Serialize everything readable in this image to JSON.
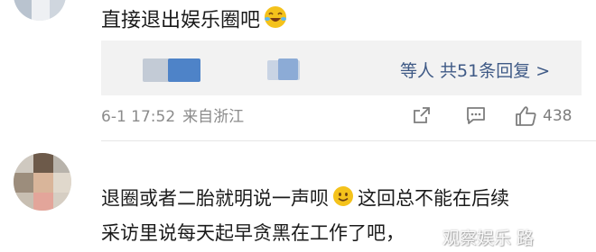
{
  "comment1": {
    "text": "直接退出娱乐圈吧",
    "emoji": "laughing-tears-face",
    "replies": {
      "summary": "等人 共51条回复",
      "chevron": ">"
    },
    "meta": {
      "date": "6-1 17:52",
      "location": "来自浙江"
    },
    "like_count": "438"
  },
  "comment2": {
    "line1": "退圈或者二胎就明说一声呗",
    "line1_after_emoji": "这回总不能在后续",
    "line2": "采访里说每天起早贪黑在工作了吧，",
    "emoji": "smiley-face"
  },
  "watermark": "观察娱乐  路",
  "colors": {
    "link": "#3f5a86",
    "meta": "#8b8b8b",
    "reply_bg": "#f2f2f2",
    "emoji": "#f4c21b"
  }
}
